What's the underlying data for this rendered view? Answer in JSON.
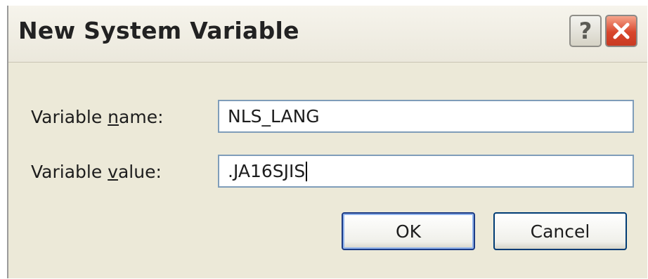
{
  "dialog": {
    "title": "New System Variable",
    "title_buttons": {
      "help_label": "?",
      "close_icon": "close-icon"
    }
  },
  "form": {
    "variable_name": {
      "label_prefix": "Variable ",
      "label_accel": "n",
      "label_suffix": "ame:",
      "value": "NLS_LANG"
    },
    "variable_value": {
      "label_prefix": "Variable ",
      "label_accel": "v",
      "label_suffix": "alue:",
      "value": ".JA16SJIS"
    }
  },
  "buttons": {
    "ok_label": "OK",
    "cancel_label": "Cancel"
  },
  "colors": {
    "dialog_bg": "#ece9d8",
    "field_border": "#7f9db9",
    "close_button": "#d8462c"
  }
}
